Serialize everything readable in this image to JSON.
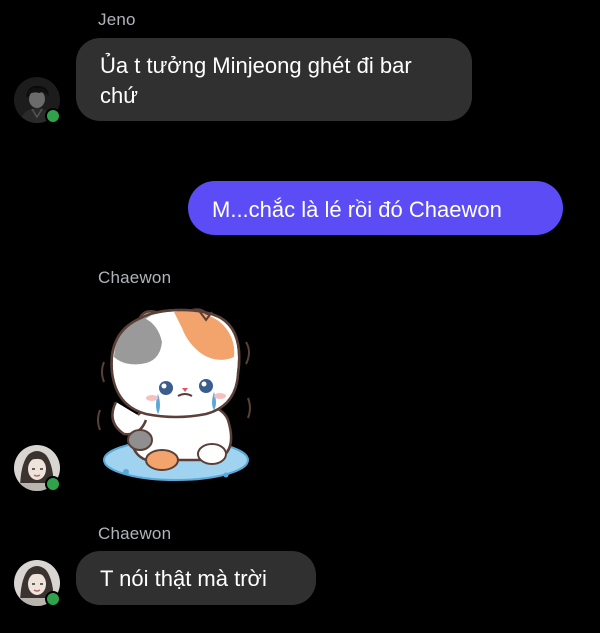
{
  "colors": {
    "background": "#000000",
    "incoming_bubble": "#303030",
    "outgoing_bubble": "#5b4cf5",
    "sender_name": "#b0b3b8",
    "online_status": "#31a24c"
  },
  "messages": [
    {
      "sender": "Jeno",
      "direction": "incoming",
      "text_line1": "Ủa t tưởng Minjeong ghét đi bar",
      "text_line2": "chứ"
    },
    {
      "sender": "",
      "direction": "outgoing",
      "text": "M...chắc là lé rồi đó Chaewon"
    },
    {
      "sender": "Chaewon",
      "direction": "incoming",
      "type": "sticker",
      "sticker_icon": "crying-cat-sticker"
    },
    {
      "sender": "Chaewon",
      "direction": "incoming",
      "text": "T nói thật mà trời"
    }
  ]
}
